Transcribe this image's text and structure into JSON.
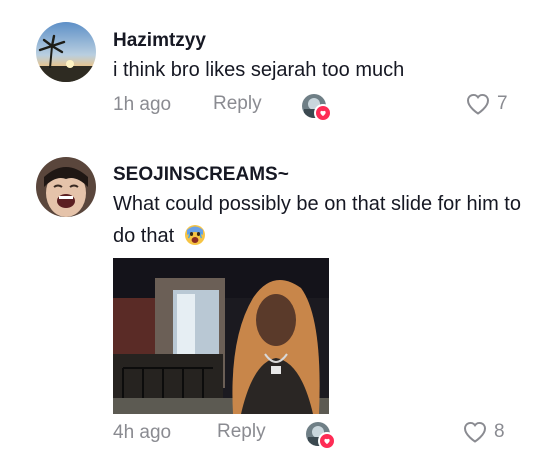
{
  "comments": [
    {
      "username": "Hazimtzyy",
      "text": "i think bro likes sejarah too much",
      "time": "1h ago",
      "reply_label": "Reply",
      "likes": "7",
      "avatar_icon": "sunset-palm-avatar",
      "liked_by_icon": "creator-avatar"
    },
    {
      "username": "SEOJINSCREAMS~",
      "text": "What could possibly be on that slide for him to do that",
      "emoji": "crying-face-emoji",
      "time": "4h ago",
      "reply_label": "Reply",
      "likes": "8",
      "avatar_icon": "laughing-person-avatar",
      "liked_by_icon": "creator-avatar",
      "attachment_icon": "reaction-photo"
    }
  ],
  "colors": {
    "text": "#161823",
    "meta": "#8a8b91",
    "accent": "#fe2c55"
  }
}
